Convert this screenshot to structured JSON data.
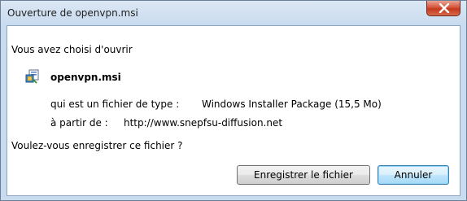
{
  "window": {
    "title": "Ouverture de openvpn.msi"
  },
  "dialog": {
    "intro": "Vous avez choisi d'ouvrir",
    "file_icon": "msi-installer-icon",
    "filename": "openvpn.msi",
    "type_label": "qui est un fichier de type :",
    "type_value": "Windows Installer Package (15,5 Mo)",
    "from_label": "à partir de :",
    "from_value": "http://www.snepfsu-diffusion.net",
    "question": "Voulez-vous enregistrer ce fichier ?"
  },
  "buttons": {
    "save_label": "Enregistrer le fichier",
    "cancel_label": "Annuler"
  },
  "colors": {
    "close_button": "#c4381c",
    "focused_button_border": "#3c7fb1"
  }
}
